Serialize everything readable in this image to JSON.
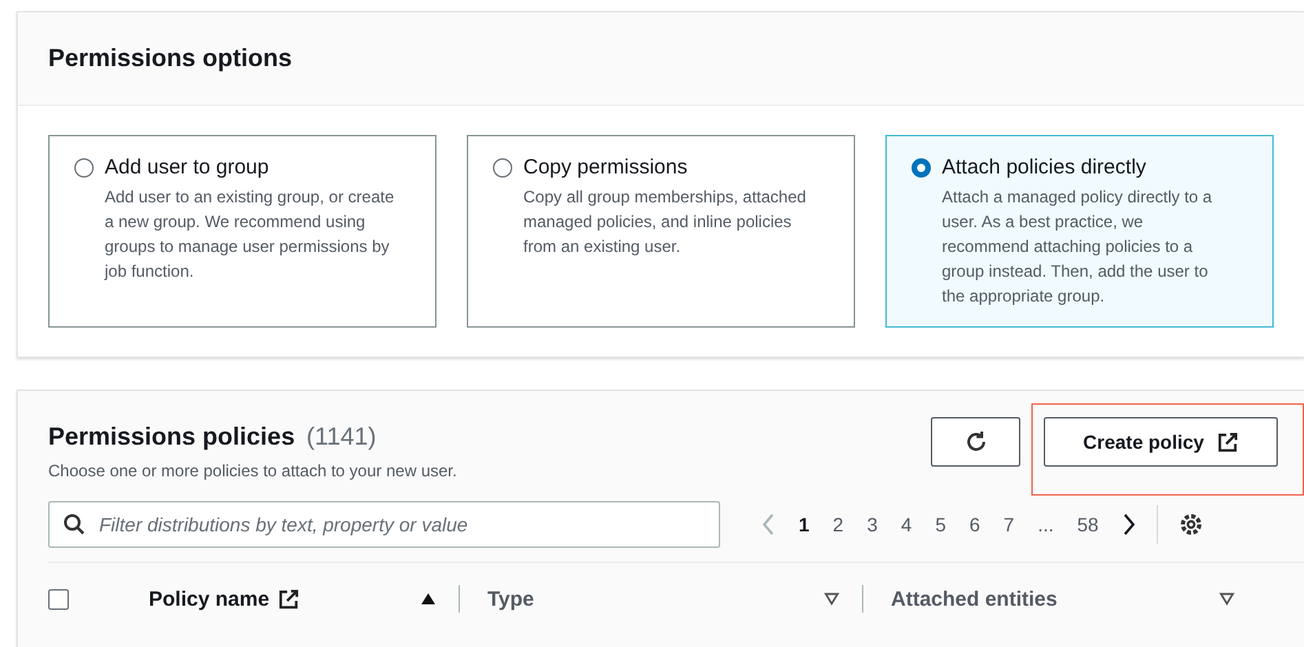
{
  "options_panel": {
    "title": "Permissions options",
    "options": [
      {
        "label": "Add user to group",
        "description": "Add user to an existing group, or create a new group. We recommend using groups to manage user permissions by job function.",
        "selected": false
      },
      {
        "label": "Copy permissions",
        "description": "Copy all group memberships, attached managed policies, and inline policies from an existing user.",
        "selected": false
      },
      {
        "label": "Attach policies directly",
        "description": "Attach a managed policy directly to a user. As a best practice, we recommend attaching policies to a group instead. Then, add the user to the appropriate group.",
        "selected": true
      }
    ]
  },
  "policies_panel": {
    "title": "Permissions policies",
    "count": "(1141)",
    "subtitle": "Choose one or more policies to attach to your new user.",
    "create_button": {
      "label": "Create policy",
      "highlighted": true
    },
    "search": {
      "placeholder": "Filter distributions by text, property or value"
    },
    "pagination": {
      "prev_disabled": true,
      "next_disabled": false,
      "pages": [
        {
          "label": "1",
          "selected": true
        },
        {
          "label": "2",
          "selected": false
        },
        {
          "label": "3",
          "selected": false
        },
        {
          "label": "4",
          "selected": false
        },
        {
          "label": "5",
          "selected": false
        },
        {
          "label": "6",
          "selected": false
        },
        {
          "label": "7",
          "selected": false
        },
        {
          "label": "...",
          "selected": false
        },
        {
          "label": "58",
          "selected": false
        }
      ]
    },
    "table": {
      "select_all_checked": false,
      "columns": [
        {
          "label": "Policy name",
          "external": true,
          "sorted": true
        },
        {
          "label": "Type",
          "external": false,
          "sorted": false
        },
        {
          "label": "Attached entities",
          "external": false,
          "sorted": false
        }
      ]
    }
  }
}
